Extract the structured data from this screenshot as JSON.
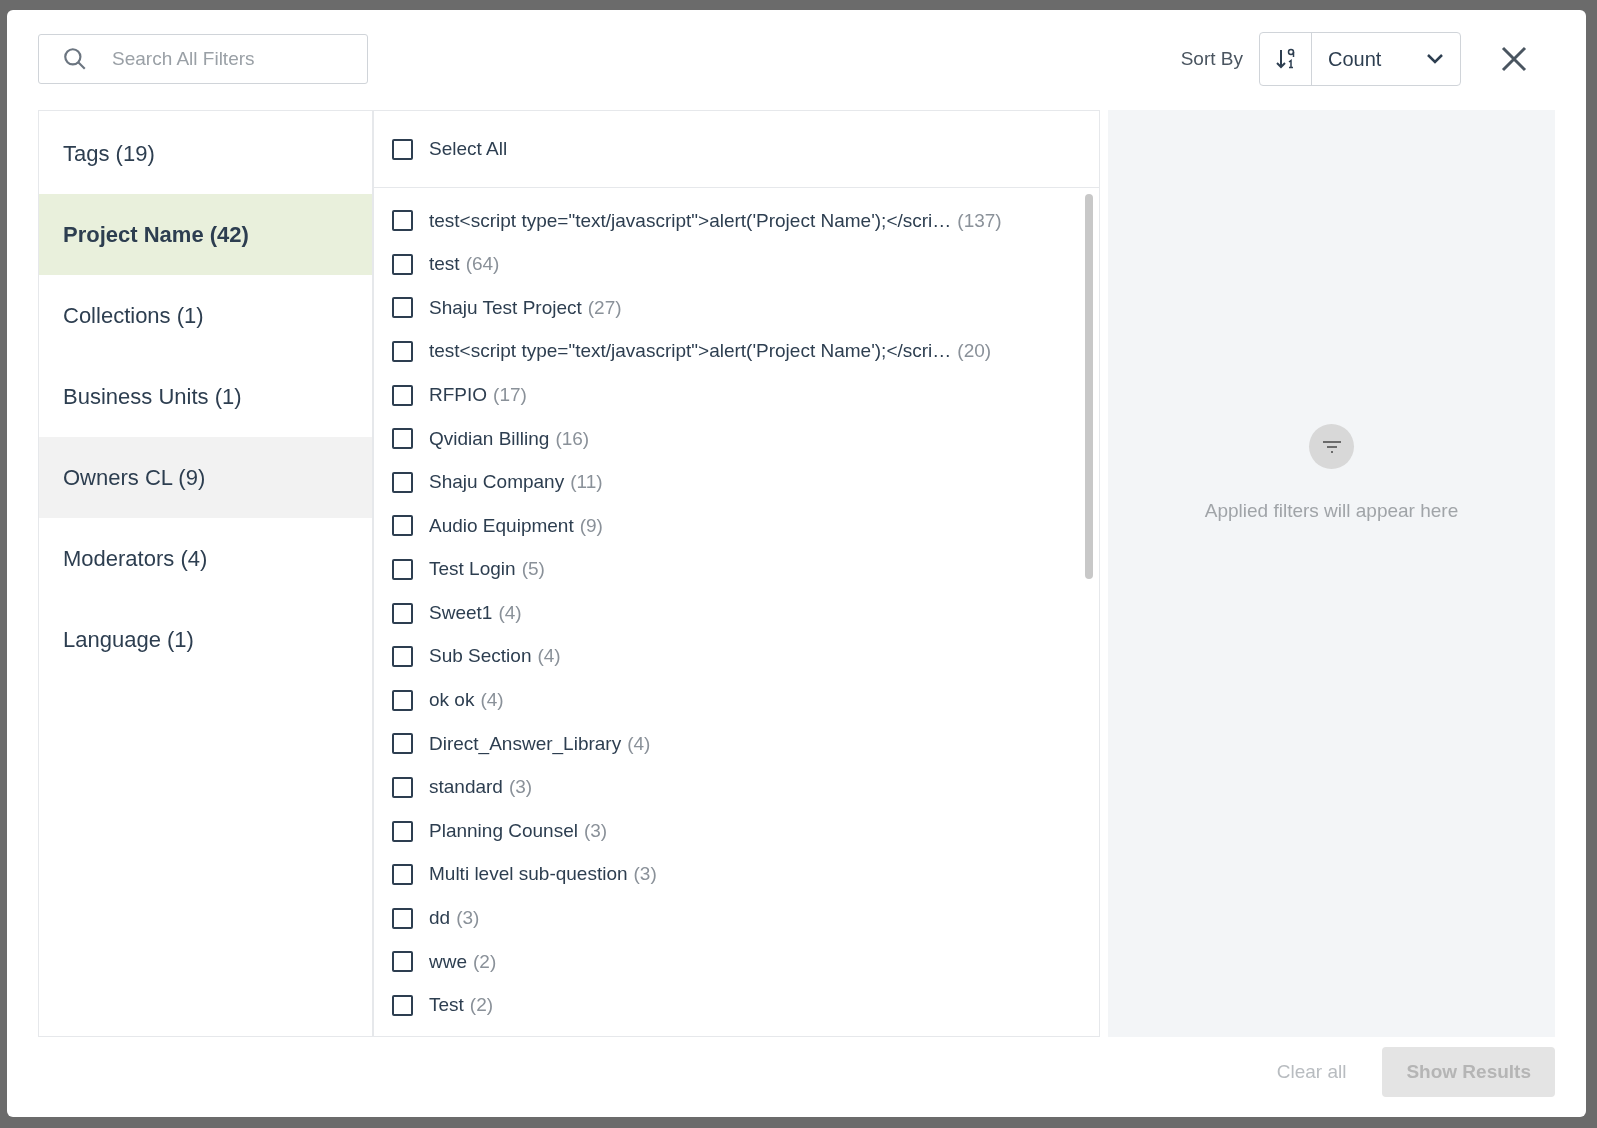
{
  "search": {
    "placeholder": "Search All Filters"
  },
  "sort": {
    "label": "Sort By",
    "value": "Count"
  },
  "categories": [
    {
      "label": "Tags",
      "count": "(19)",
      "selected": false,
      "hovered": false
    },
    {
      "label": "Project Name",
      "count": "(42)",
      "selected": true,
      "hovered": false
    },
    {
      "label": "Collections",
      "count": "(1)",
      "selected": false,
      "hovered": false
    },
    {
      "label": "Business Units",
      "count": "(1)",
      "selected": false,
      "hovered": false
    },
    {
      "label": "Owners CL",
      "count": "(9)",
      "selected": false,
      "hovered": true
    },
    {
      "label": "Moderators",
      "count": "(4)",
      "selected": false,
      "hovered": false
    },
    {
      "label": "Language",
      "count": "(1)",
      "selected": false,
      "hovered": false
    }
  ],
  "select_all": {
    "label": "Select All",
    "checked": false
  },
  "options": [
    {
      "label": "test<script type=\"text/javascript\">alert('Project Name');</scri…",
      "count": "(137)",
      "checked": false
    },
    {
      "label": "test",
      "count": "(64)",
      "checked": false
    },
    {
      "label": "Shaju Test Project",
      "count": "(27)",
      "checked": false
    },
    {
      "label": "test<script type=\"text/javascript\">alert('Project Name');</scri…",
      "count": "(20)",
      "checked": false
    },
    {
      "label": "RFPIO",
      "count": "(17)",
      "checked": false
    },
    {
      "label": "Qvidian Billing",
      "count": "(16)",
      "checked": false
    },
    {
      "label": "Shaju Company",
      "count": "(11)",
      "checked": false
    },
    {
      "label": "Audio Equipment",
      "count": "(9)",
      "checked": false
    },
    {
      "label": "Test Login",
      "count": "(5)",
      "checked": false
    },
    {
      "label": "Sweet1",
      "count": "(4)",
      "checked": false
    },
    {
      "label": "Sub Section",
      "count": "(4)",
      "checked": false
    },
    {
      "label": "ok ok",
      "count": "(4)",
      "checked": false
    },
    {
      "label": "Direct_Answer_Library",
      "count": "(4)",
      "checked": false
    },
    {
      "label": "standard",
      "count": "(3)",
      "checked": false
    },
    {
      "label": "Planning Counsel",
      "count": "(3)",
      "checked": false
    },
    {
      "label": "Multi level sub-question",
      "count": "(3)",
      "checked": false
    },
    {
      "label": "dd",
      "count": "(3)",
      "checked": false
    },
    {
      "label": "wwe",
      "count": "(2)",
      "checked": false
    },
    {
      "label": "Test",
      "count": "(2)",
      "checked": false
    }
  ],
  "applied": {
    "empty_text": "Applied filters will appear here"
  },
  "footer": {
    "clear": {
      "label": "Clear all",
      "disabled": true
    },
    "show": {
      "label": "Show Results",
      "disabled": true
    }
  }
}
